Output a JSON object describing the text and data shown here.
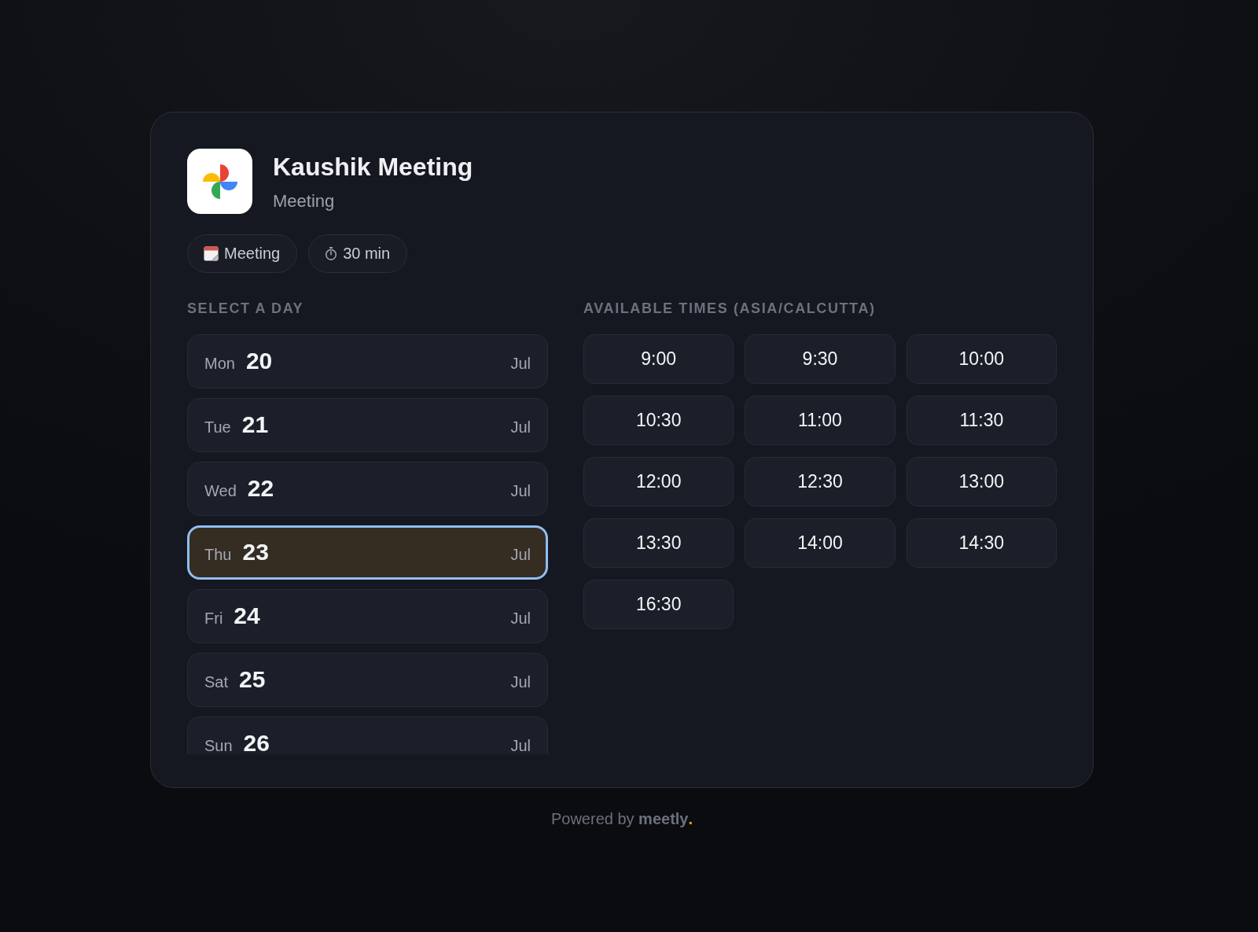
{
  "event": {
    "title": "Kaushik Meeting",
    "subtitle": "Meeting",
    "tags": [
      {
        "kind": "type",
        "label": "Meeting"
      },
      {
        "kind": "duration",
        "label": "30 min"
      }
    ]
  },
  "day_picker": {
    "heading": "SELECT A DAY",
    "days": [
      {
        "weekday": "Mon",
        "date": "20",
        "month": "Jul",
        "selected": false
      },
      {
        "weekday": "Tue",
        "date": "21",
        "month": "Jul",
        "selected": false
      },
      {
        "weekday": "Wed",
        "date": "22",
        "month": "Jul",
        "selected": false
      },
      {
        "weekday": "Thu",
        "date": "23",
        "month": "Jul",
        "selected": true
      },
      {
        "weekday": "Fri",
        "date": "24",
        "month": "Jul",
        "selected": false
      },
      {
        "weekday": "Sat",
        "date": "25",
        "month": "Jul",
        "selected": false
      },
      {
        "weekday": "Sun",
        "date": "26",
        "month": "Jul",
        "selected": false
      }
    ]
  },
  "time_picker": {
    "heading": "AVAILABLE TIMES (ASIA/CALCUTTA)",
    "slots": [
      "9:00",
      "9:30",
      "10:00",
      "10:30",
      "11:00",
      "11:30",
      "12:00",
      "12:30",
      "13:00",
      "13:30",
      "14:00",
      "14:30",
      "16:30"
    ]
  },
  "footer": {
    "text": "Powered by **meetly**",
    "brand_suffix": "."
  }
}
